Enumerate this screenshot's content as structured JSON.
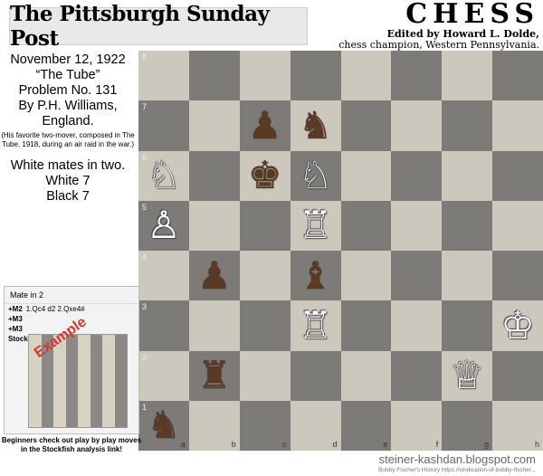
{
  "masthead": "The Pittsburgh Sunday Post",
  "chess_header": {
    "title": "CHESS",
    "line1": "Edited by Howard L. Dolde,",
    "line2": "chess champion, Western Pennsylvania."
  },
  "problem": {
    "date": "November 12, 1922",
    "name": "“The Tube”",
    "number": "Problem No. 131",
    "author": "By P.H. Williams,",
    "country": "England.",
    "note": "(His favorite two-mover, composed in The Tube, 1918, during an air raid in the war.)",
    "task": "White mates in two.",
    "white_count": "White 7",
    "black_count": "Black 7"
  },
  "board": {
    "ranks": [
      "8",
      "7",
      "6",
      "5",
      "4",
      "3",
      "2",
      "1"
    ],
    "files": [
      "a",
      "b",
      "c",
      "d",
      "e",
      "f",
      "g",
      "h"
    ],
    "pieces": [
      {
        "square": "c7",
        "glyph": "♟",
        "color": "b",
        "name": "black-pawn-c7"
      },
      {
        "square": "d7",
        "glyph": "♞",
        "color": "b",
        "name": "black-knight-d7"
      },
      {
        "square": "a6",
        "glyph": "♘",
        "color": "w",
        "name": "white-knight-a6"
      },
      {
        "square": "c6",
        "glyph": "♚",
        "color": "b",
        "name": "black-king-c6"
      },
      {
        "square": "d6",
        "glyph": "♘",
        "color": "w",
        "name": "white-knight-d6"
      },
      {
        "square": "a5",
        "glyph": "♙",
        "color": "w",
        "name": "white-pawn-a5"
      },
      {
        "square": "d5",
        "glyph": "♖",
        "color": "w",
        "name": "white-rook-d5"
      },
      {
        "square": "b4",
        "glyph": "♟",
        "color": "b",
        "name": "black-pawn-b4"
      },
      {
        "square": "d4",
        "glyph": "♝",
        "color": "b",
        "name": "black-bishop-d4"
      },
      {
        "square": "d3",
        "glyph": "♖",
        "color": "w",
        "name": "white-rook-d3"
      },
      {
        "square": "h3",
        "glyph": "♔",
        "color": "w",
        "name": "white-king-h3"
      },
      {
        "square": "b2",
        "glyph": "♜",
        "color": "b",
        "name": "black-rook-b2"
      },
      {
        "square": "g2",
        "glyph": "♕",
        "color": "w",
        "name": "white-queen-g2"
      },
      {
        "square": "a1",
        "glyph": "♞",
        "color": "b",
        "name": "black-knight-a1"
      }
    ]
  },
  "analysis_panel": {
    "title": "Mate in 2",
    "lines": [
      {
        "tag": "+M2",
        "moves": "1.Qc4 d2 2.Qxe4#"
      },
      {
        "tag": "+M3",
        "moves": ""
      },
      {
        "tag": "+M3",
        "moves": ""
      },
      {
        "tag": "Stock",
        "moves": ""
      }
    ],
    "example_label": "Example"
  },
  "caption": "Beginners check out play by play moves in the Stockfish analysis link!",
  "footer": {
    "site": "steiner-kashdan.blogspot.com",
    "credit": "Bobby Fischer's History https://vindication-of-bobby-fischer..."
  }
}
